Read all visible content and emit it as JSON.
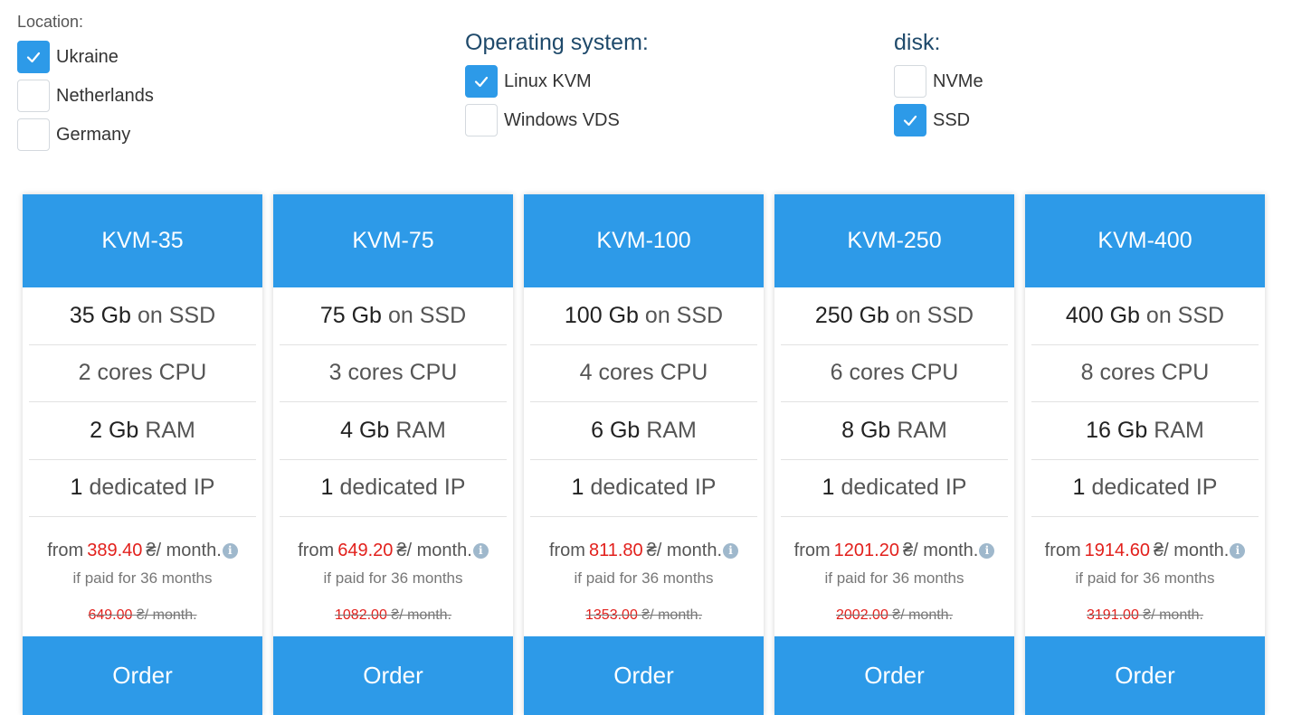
{
  "filters": {
    "location": {
      "title": "Location:",
      "options": [
        {
          "label": "Ukraine",
          "checked": true
        },
        {
          "label": "Netherlands",
          "checked": false
        },
        {
          "label": "Germany",
          "checked": false
        }
      ]
    },
    "os": {
      "title": "Operating system:",
      "options": [
        {
          "label": "Linux KVM",
          "checked": true
        },
        {
          "label": "Windows VDS",
          "checked": false
        }
      ]
    },
    "disk": {
      "title": "disk:",
      "options": [
        {
          "label": "NVMe",
          "checked": false
        },
        {
          "label": "SSD",
          "checked": true
        }
      ]
    }
  },
  "plans": [
    {
      "name": "KVM-35",
      "disk_value": "35 Gb",
      "disk_unit": "on SSD",
      "cpu": "2 cores CPU",
      "ram_value": "2 Gb",
      "ram_unit": "RAM",
      "ip_value": "1",
      "ip_unit": "dedicated IP",
      "price_prefix": "from",
      "price": "389.40",
      "price_suffix": "₴/ month.",
      "paid_note": "if paid for 36 months",
      "old_price": "649.00",
      "old_suffix": "₴/ month.",
      "order_label": "Order"
    },
    {
      "name": "KVM-75",
      "disk_value": "75 Gb",
      "disk_unit": "on SSD",
      "cpu": "3 cores CPU",
      "ram_value": "4 Gb",
      "ram_unit": "RAM",
      "ip_value": "1",
      "ip_unit": "dedicated IP",
      "price_prefix": "from",
      "price": "649.20",
      "price_suffix": "₴/ month.",
      "paid_note": "if paid for 36 months",
      "old_price": "1082.00",
      "old_suffix": "₴/ month.",
      "order_label": "Order"
    },
    {
      "name": "KVM-100",
      "disk_value": "100 Gb",
      "disk_unit": "on SSD",
      "cpu": "4 cores CPU",
      "ram_value": "6 Gb",
      "ram_unit": "RAM",
      "ip_value": "1",
      "ip_unit": "dedicated IP",
      "price_prefix": "from",
      "price": "811.80",
      "price_suffix": "₴/ month.",
      "paid_note": "if paid for 36 months",
      "old_price": "1353.00",
      "old_suffix": "₴/ month.",
      "order_label": "Order"
    },
    {
      "name": "KVM-250",
      "disk_value": "250 Gb",
      "disk_unit": "on SSD",
      "cpu": "6 cores CPU",
      "ram_value": "8 Gb",
      "ram_unit": "RAM",
      "ip_value": "1",
      "ip_unit": "dedicated IP",
      "price_prefix": "from",
      "price": "1201.20",
      "price_suffix": "₴/ month.",
      "paid_note": "if paid for 36 months",
      "old_price": "2002.00",
      "old_suffix": "₴/ month.",
      "order_label": "Order"
    },
    {
      "name": "KVM-400",
      "disk_value": "400 Gb",
      "disk_unit": "on SSD",
      "cpu": "8 cores CPU",
      "ram_value": "16 Gb",
      "ram_unit": "RAM",
      "ip_value": "1",
      "ip_unit": "dedicated IP",
      "price_prefix": "from",
      "price": "1914.60",
      "price_suffix": "₴/ month.",
      "paid_note": "if paid for 36 months",
      "old_price": "3191.00",
      "old_suffix": "₴/ month.",
      "order_label": "Order"
    }
  ],
  "colors": {
    "accent": "#2d9ae8",
    "price": "#e2201c"
  },
  "icons": {
    "checkbox_checked": "checkmark-icon",
    "price_info": "info-icon"
  }
}
